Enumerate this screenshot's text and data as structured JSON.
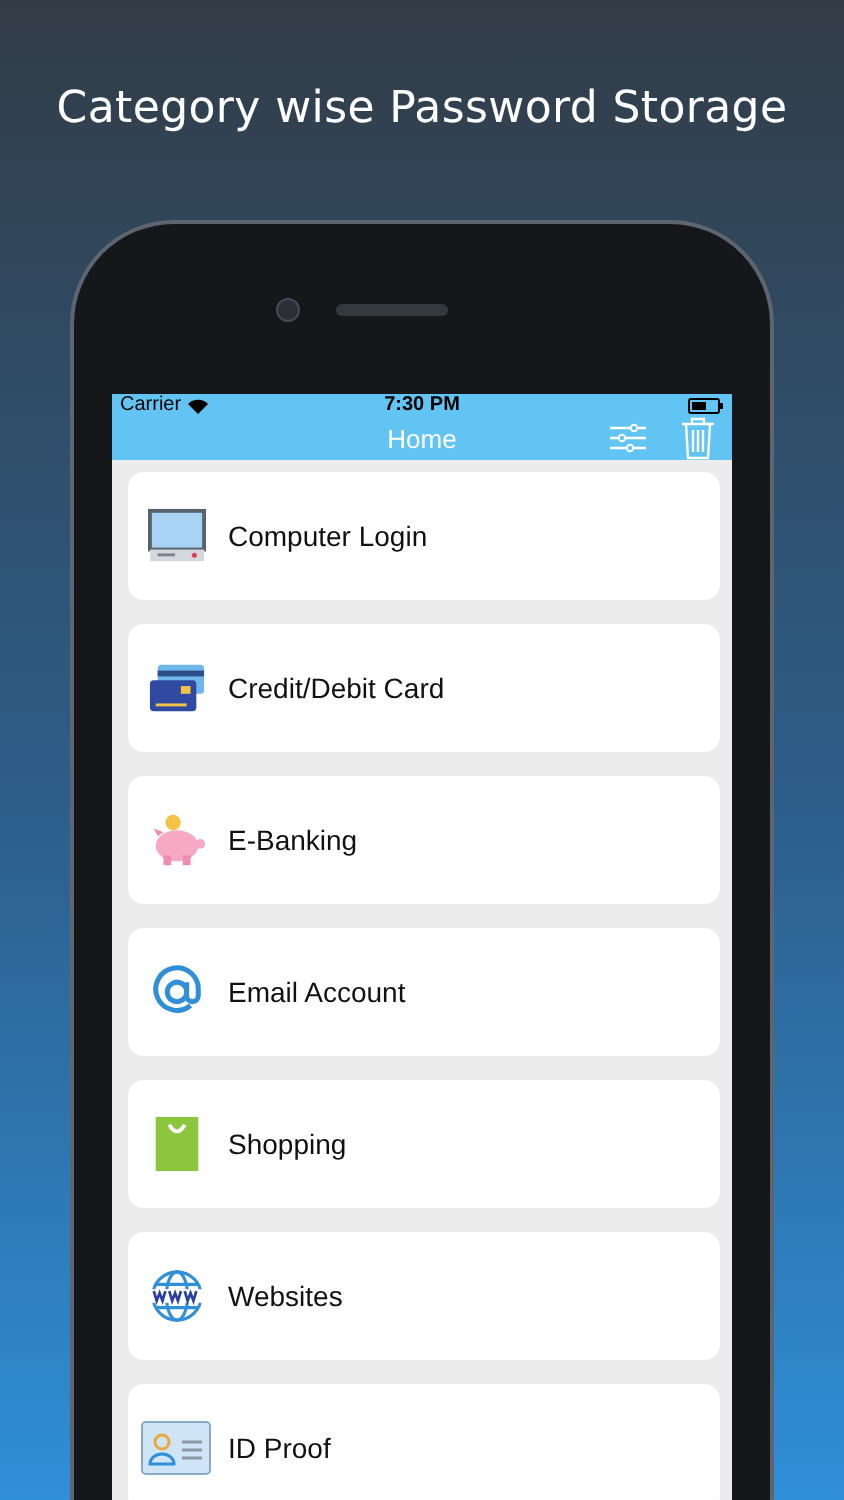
{
  "headline": "Category wise Password Storage",
  "status_bar": {
    "carrier": "Carrier",
    "time": "7:30 PM"
  },
  "nav_bar": {
    "title": "Home"
  },
  "categories": [
    {
      "kind": "computer",
      "label": "Computer Login"
    },
    {
      "kind": "card",
      "label": "Credit/Debit Card"
    },
    {
      "kind": "piggy",
      "label": "E-Banking"
    },
    {
      "kind": "email",
      "label": "Email Account"
    },
    {
      "kind": "bag",
      "label": "Shopping"
    },
    {
      "kind": "globe",
      "label": "Websites"
    },
    {
      "kind": "id",
      "label": "ID Proof"
    }
  ]
}
